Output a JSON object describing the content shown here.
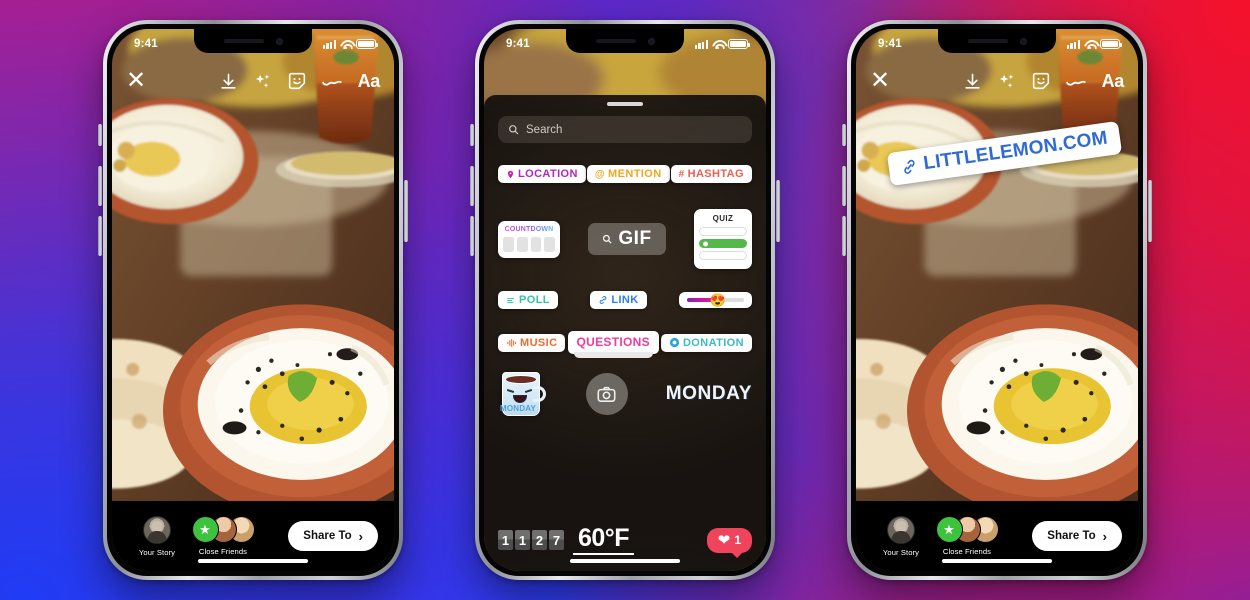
{
  "background": {
    "gradient_from": "#f5112b",
    "gradient_mid": "#a3228f",
    "gradient_to": "#1f3cf5"
  },
  "phones": [
    {
      "id": "story-editor",
      "status_bar": {
        "time": "9:41",
        "signal_icon": "cellular-signal-icon",
        "wifi_icon": "wifi-icon",
        "battery_icon": "battery-icon"
      },
      "toolbar": {
        "close_label": "✕",
        "tools": [
          {
            "name": "download-icon",
            "glyph": "download"
          },
          {
            "name": "sparkles-icon",
            "glyph": "sparkles"
          },
          {
            "name": "sticker-icon",
            "glyph": "sticker-smiley"
          },
          {
            "name": "draw-icon",
            "glyph": "squiggle"
          },
          {
            "name": "text-icon",
            "label": "Aa"
          }
        ]
      },
      "bottom_bar": {
        "your_story_label": "Your Story",
        "close_friends_label": "Close Friends",
        "share_label": "Share To",
        "share_chevron": "›"
      }
    },
    {
      "id": "sticker-tray",
      "status_bar": {
        "time": "9:41"
      },
      "tray": {
        "search_placeholder": "Search",
        "search_icon": "search-icon",
        "rows": [
          [
            {
              "name": "location-sticker",
              "label": "LOCATION",
              "glyph": "◉",
              "color": "#b426c4"
            },
            {
              "name": "mention-sticker",
              "label": "MENTION",
              "glyph": "@",
              "color": "#f0a81e"
            },
            {
              "name": "hashtag-sticker",
              "label": "HASHTAG",
              "glyph": "#",
              "color": "#ef5e52"
            }
          ],
          [
            {
              "name": "countdown-sticker",
              "label": "COUNTDOWN",
              "blocks": 4
            },
            {
              "name": "gif-sticker",
              "label": "GIF",
              "glyph": "search-icon"
            },
            {
              "name": "quiz-sticker",
              "label": "QUIZ",
              "bars": 3,
              "selected_index": 1,
              "selected_color": "#55b84b"
            }
          ],
          [
            {
              "name": "poll-sticker",
              "label": "POLL",
              "glyph": "≡",
              "color": "#35c4a8"
            },
            {
              "name": "link-sticker",
              "label": "LINK",
              "glyph": "⚭",
              "color": "#2d7ff0"
            },
            {
              "name": "emoji-slider-sticker",
              "emoji": "😍",
              "fill_percent": 46
            }
          ],
          [
            {
              "name": "music-sticker",
              "label": "MUSIC",
              "glyph": "‖",
              "color": "#ef6a31"
            },
            {
              "name": "questions-sticker",
              "label": "QUESTIONS",
              "color": "#ef3ba0"
            },
            {
              "name": "donation-sticker",
              "label": "DONATION",
              "glyph": "◉",
              "color": "#3fb8c9"
            }
          ],
          [
            {
              "name": "monday-mug-sticker",
              "label": "MONDAY"
            },
            {
              "name": "camera-sticker",
              "glyph": "camera-icon"
            },
            {
              "name": "monday-text-sticker",
              "label": "MONDAY"
            }
          ]
        ],
        "bottom_widgets": {
          "flip_clock": [
            "1",
            "1",
            "2",
            "7"
          ],
          "temperature": "60°F",
          "like_count": "1",
          "like_icon": "heart-icon"
        }
      }
    },
    {
      "id": "story-with-link",
      "status_bar": {
        "time": "9:41"
      },
      "toolbar": {
        "close_label": "✕",
        "tools": [
          {
            "name": "download-icon",
            "glyph": "download"
          },
          {
            "name": "sparkles-icon",
            "glyph": "sparkles"
          },
          {
            "name": "sticker-icon",
            "glyph": "sticker-smiley"
          },
          {
            "name": "draw-icon",
            "glyph": "squiggle"
          },
          {
            "name": "text-icon",
            "label": "Aa"
          }
        ]
      },
      "link_sticker": {
        "label": "LITTLELEMON.COM",
        "icon": "link-chain-icon",
        "color": "#2e6bd6"
      },
      "bottom_bar": {
        "your_story_label": "Your Story",
        "close_friends_label": "Close Friends",
        "share_label": "Share To",
        "share_chevron": "›"
      }
    }
  ]
}
